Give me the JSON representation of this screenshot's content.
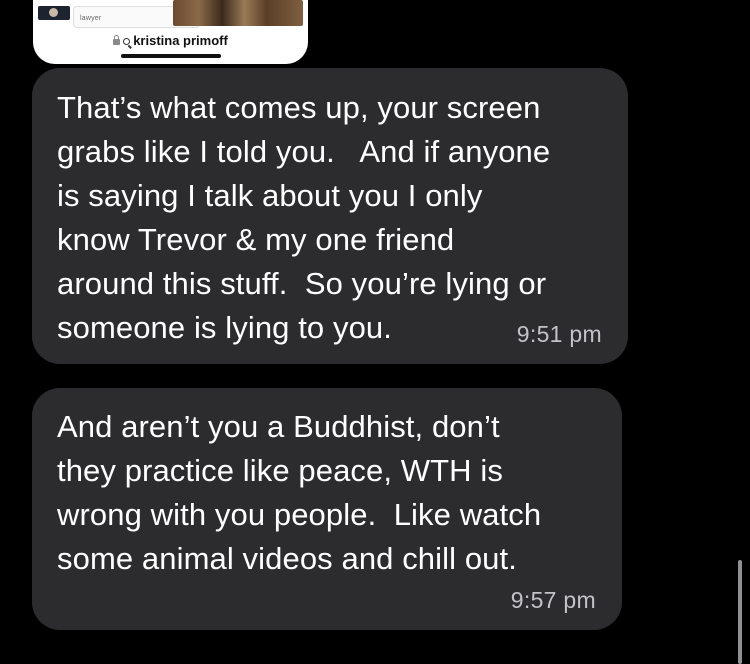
{
  "preview": {
    "card_label": "lawyer",
    "url_text": "kristina primoff",
    "lock_icon": "lock-icon",
    "search_icon": "magnifier-icon"
  },
  "messages": [
    {
      "text": "That’s what comes up, your screen\ngrabs like I told you.   And if anyone\nis saying I talk about you I only\nknow Trevor & my one friend\naround this stuff.  So you’re lying or\nsomeone is lying to you.",
      "time": "9:51 pm"
    },
    {
      "text": "And aren’t you a Buddhist, don’t\nthey practice like peace, WTH is\nwrong with you people.  Like watch\nsome animal videos and chill out.",
      "time": "9:57 pm"
    }
  ],
  "colors": {
    "background": "#000000",
    "bubble": "#2c2c2e",
    "text": "#ffffff",
    "timestamp": "#c2c2c7"
  }
}
